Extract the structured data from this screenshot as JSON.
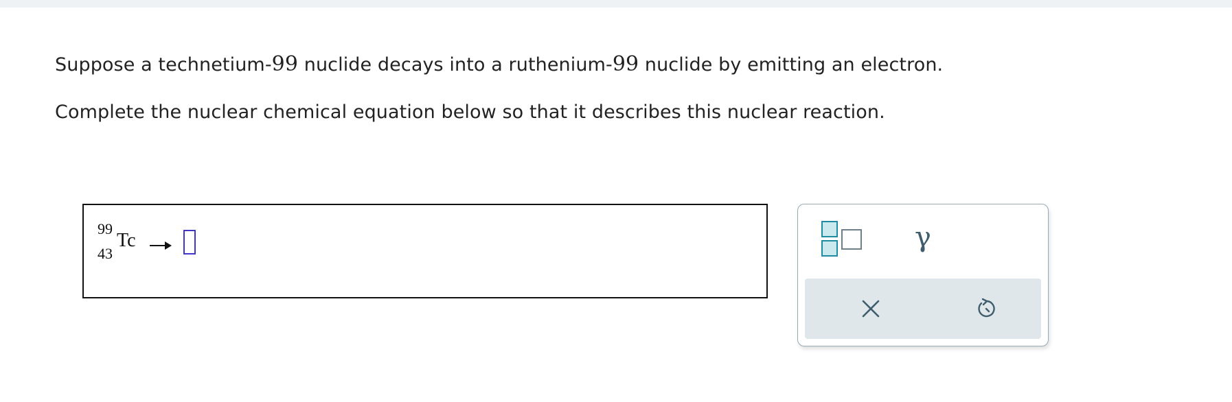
{
  "question": {
    "line1_a": "Suppose a technetium-",
    "line1_num1": "99",
    "line1_b": " nuclide decays into a ruthenium-",
    "line1_num2": "99",
    "line1_c": " nuclide by emitting an electron.",
    "line2": "Complete the nuclear chemical equation below so that it describes this nuclear reaction."
  },
  "equation": {
    "mass_number": "99",
    "atomic_number": "43",
    "symbol": "Tc",
    "answer_value": ""
  },
  "tools": {
    "gamma_symbol": "γ",
    "icons": {
      "superscript_subscript": "superscript-subscript-icon",
      "gamma": "gamma-icon",
      "clear": "close-icon",
      "undo": "undo-icon"
    }
  },
  "colors": {
    "top_strip": "#eef2f4",
    "answer_slot_border": "#3f36c8",
    "tool_accent": "#1e8b9e",
    "tool_bar_bg": "#e0e7ea",
    "icon_color": "#3f5d6c"
  }
}
